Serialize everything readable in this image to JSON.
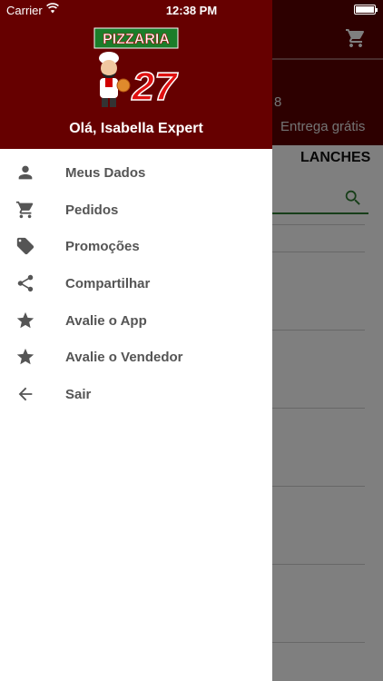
{
  "status_bar": {
    "carrier": "Carrier",
    "time": "12:38 PM"
  },
  "logo": {
    "line1": "PIZZARIA",
    "line2": "27"
  },
  "drawer": {
    "greeting": "Olá, Isabella Expert",
    "items": [
      {
        "label": "Meus Dados",
        "icon": "person-icon"
      },
      {
        "label": "Pedidos",
        "icon": "cart-icon"
      },
      {
        "label": "Promoções",
        "icon": "tag-icon"
      },
      {
        "label": "Compartilhar",
        "icon": "share-icon"
      },
      {
        "label": "Avalie o App",
        "icon": "star-icon"
      },
      {
        "label": "Avalie o Vendedor",
        "icon": "star-icon"
      },
      {
        "label": "Sair",
        "icon": "back-arrow-icon"
      }
    ]
  },
  "background": {
    "number_fragment": "8",
    "delivery_text": "Entrega grátis",
    "tab_label": "LANCHES"
  },
  "colors": {
    "header_bg": "#660000",
    "icon_color": "#555555",
    "label_color": "#555555",
    "accent_green": "#2e7d32"
  }
}
